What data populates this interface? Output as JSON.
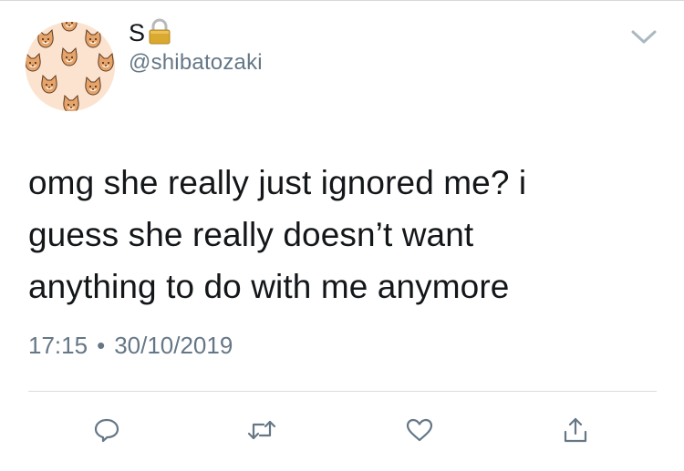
{
  "author": {
    "display_name": "S",
    "handle": "@shibatozaki",
    "protected": true,
    "avatar_icon": "shiba-pattern-avatar"
  },
  "tweet": {
    "text": "omg she really just ignored me? i\nguess she really doesn’t want\nanything to do with me anymore",
    "time": "17:15",
    "separator": "•",
    "date": "30/10/2019"
  },
  "actions": [
    {
      "icon": "reply-icon"
    },
    {
      "icon": "retweet-icon"
    },
    {
      "icon": "like-icon"
    },
    {
      "icon": "share-icon"
    }
  ],
  "icons": {
    "menu": "chevron-down-icon",
    "protected": "lock-icon"
  },
  "colors": {
    "text": "#14171a",
    "secondary": "#657786",
    "icon": "#657786",
    "lock": "#d9a930",
    "avatar_bg": "#fbe3cf"
  }
}
